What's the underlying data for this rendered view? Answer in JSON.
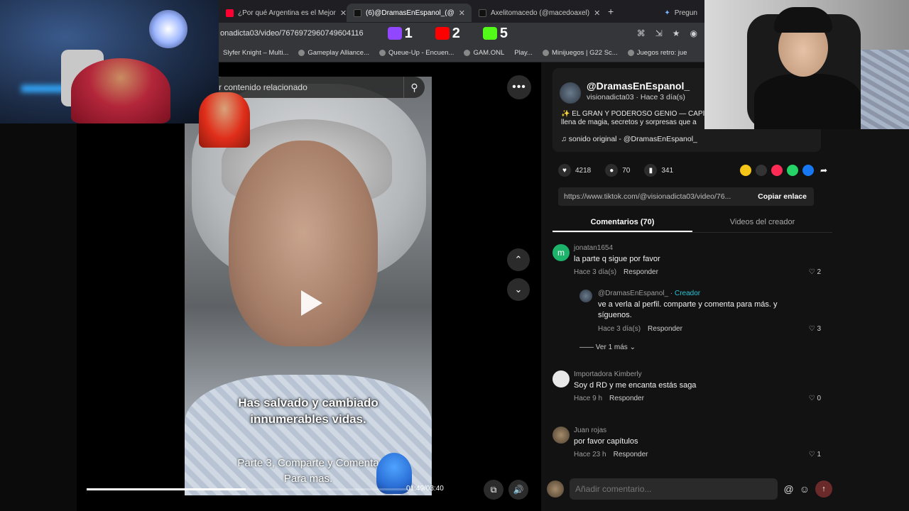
{
  "browser": {
    "tabs": [
      {
        "label": "¿Por qué Argentina es el Mejor",
        "icon": "youtube-icon",
        "active": false
      },
      {
        "label": "(6)@DramasEnEspanol_(@",
        "icon": "tiktok-icon",
        "active": true
      },
      {
        "label": "Axelitomacedo (@macedoaxel)",
        "icon": "tiktok-icon",
        "active": false
      }
    ],
    "new_tab": "+",
    "side_tab": "Pregun",
    "url": "onadicta03/video/7676972960749604116",
    "bookmarks": [
      "Slyfer Knight – Multi...",
      "Gameplay Alliance...",
      "Queue-Up - Encuen...",
      "GAM.ONL",
      "Play...",
      "Minijuegos | G22 Sc...",
      "Juegos retro: jue"
    ]
  },
  "stream_overlay": {
    "twitch_count": "1",
    "youtube_count": "2",
    "kick_count": "5"
  },
  "video": {
    "search_placeholder": "r contenido relacionado",
    "subtitle_line1": "Has salvado y cambiado",
    "subtitle_line2": "innumerables vidas.",
    "caption_line1": "Parte 3, Comparte y Comenta",
    "caption_line2": "Para mas.",
    "time": "01:49/03:40",
    "progress": 0.495
  },
  "post": {
    "handle": "@DramasEnEspanol_",
    "meta": "visionadicta03 · Hace 3 día(s)",
    "desc_line1": "✨ EL GRAN Y PODEROSO GENIO — CAPÍ",
    "desc_line2": "llena de magia, secretos y sorpresas que a",
    "music": "♫  sonido original - @DramasEnEspanol_",
    "likes": "4218",
    "comments": "70",
    "saves": "341",
    "link": "https://www.tiktok.com/@visionadicta03/video/76...",
    "copy_label": "Copiar enlace"
  },
  "panel_tabs": {
    "comments": "Comentarios (70)",
    "creator_videos": "Videos del creador"
  },
  "comments": [
    {
      "user": "jonatan1654",
      "text": "la parte q sigue por favor",
      "time": "Hace 3 día(s)",
      "reply": "Responder",
      "likes": "2",
      "avatar_letter": "m"
    },
    {
      "user": "@DramasEnEspanol_",
      "creator_tag": "Creador",
      "text1": "ve a verla al perfil. comparte y comenta para más. y",
      "text2": "síguenos.",
      "time": "Hace 3 día(s)",
      "reply": "Responder",
      "likes": "3"
    },
    {
      "more": "Ver 1 más"
    },
    {
      "user": "Importadora Kimberly",
      "text": "Soy d RD y me encanta estás saga",
      "time": "Hace 9 h",
      "reply": "Responder",
      "likes": "0"
    },
    {
      "user": "Juan rojas",
      "text": "por favor capítulos",
      "time": "Hace 23 h",
      "reply": "Responder",
      "likes": "1"
    }
  ],
  "add_comment": {
    "placeholder": "Añadir comentario..."
  },
  "colors": {
    "accent": "#fe2c55",
    "creator": "#25c4d6",
    "background": "#121212"
  }
}
